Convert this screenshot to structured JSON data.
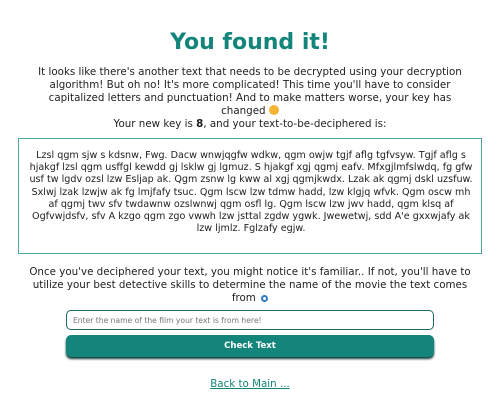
{
  "page": {
    "title": "You found it!",
    "intro": "It looks like there's another text that needs to be decrypted using your decryption algorithm! But oh no! It's more complicated! This time you'll have to consider capitalized letters and punctuation! And to make matters worse, your key has changed",
    "intro_emoji": "grinning-sweat-emoji",
    "key_prefix": "Your new key is ",
    "key_value": "8",
    "key_suffix": ", and your text-to-be-deciphered is:",
    "ciphertext": "Lzsl qgm sjw s kdsnw, Fwg. Dacw wnwjqgfw wdkw, qgm owjw tgjf aflg tgfvsyw. Tgjf aflg s hjakgf lzsl qgm usffgl kewdd gj lsklw gj lgmuz. S hjakgf xgj qgmj eafv. Mfxgjlmfslwdq, fg gfw usf tw lgdv ozsl lzw Esljap ak. Qgm zsnw lg kww al xgj qgmjkwdx. Lzak ak qgmj dskl uzsfuw. Sxlwj lzak lzwjw ak fg lmjfafy tsuc. Qgm lscw lzw tdmw hadd, lzw klgjq wfvk. Qgm oscw mh af qgmj twv sfv twdawnw ozslwnwj qgm osfl lg. Qgm lscw lzw jwv hadd, qgm klsq af Ogfvwjdsfv, sfv A kzgo qgm zgo vwwh lzw jsttal zgdw ygwk. Jwewetwj, sdd A'e gxxwjafy ak lzw ljmlz. Fglzafy egjw.",
    "followup": "Once you've deciphered your text, you might notice it's familiar.. If not, you'll have to utilize your best detective skills to determine the name of the movie the text comes from",
    "followup_icon": "magnifying-glass-icon"
  },
  "form": {
    "answer_value": "",
    "answer_placeholder": "Enter the name of the film your text is from here!",
    "submit_label": "Check Text"
  },
  "footer": {
    "back_link": "Back to Main ..."
  },
  "colors": {
    "accent": "#14857a",
    "border": "#4ea69d",
    "text": "#1f1f1f"
  }
}
